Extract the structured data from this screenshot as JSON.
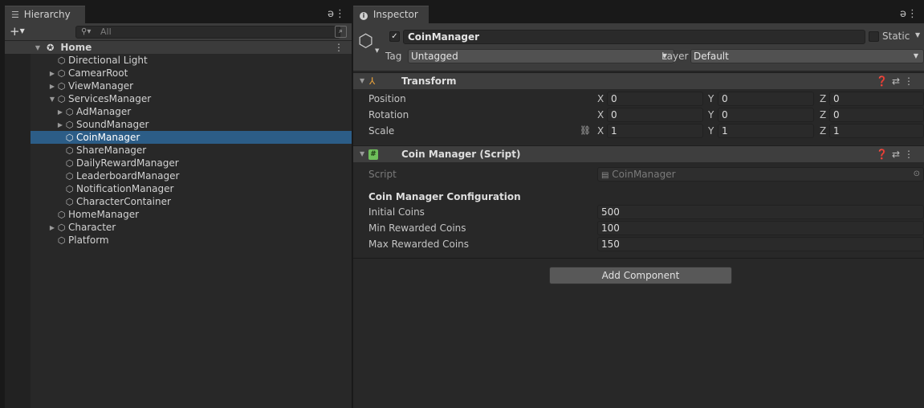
{
  "hierarchy": {
    "tab_label": "Hierarchy",
    "search_placeholder": "All",
    "scene_name": "Home",
    "items": [
      {
        "label": "Directional Light",
        "depth": 1,
        "expander": "",
        "selected": false
      },
      {
        "label": "CamearRoot",
        "depth": 1,
        "expander": "collapsed",
        "selected": false
      },
      {
        "label": "ViewManager",
        "depth": 1,
        "expander": "collapsed",
        "selected": false
      },
      {
        "label": "ServicesManager",
        "depth": 1,
        "expander": "expanded",
        "selected": false
      },
      {
        "label": "AdManager",
        "depth": 2,
        "expander": "collapsed",
        "selected": false
      },
      {
        "label": "SoundManager",
        "depth": 2,
        "expander": "collapsed",
        "selected": false
      },
      {
        "label": "CoinManager",
        "depth": 2,
        "expander": "",
        "selected": true
      },
      {
        "label": "ShareManager",
        "depth": 2,
        "expander": "",
        "selected": false
      },
      {
        "label": "DailyRewardManager",
        "depth": 2,
        "expander": "",
        "selected": false
      },
      {
        "label": "LeaderboardManager",
        "depth": 2,
        "expander": "",
        "selected": false
      },
      {
        "label": "NotificationManager",
        "depth": 2,
        "expander": "",
        "selected": false
      },
      {
        "label": "CharacterContainer",
        "depth": 2,
        "expander": "",
        "selected": false
      },
      {
        "label": "HomeManager",
        "depth": 1,
        "expander": "",
        "selected": false
      },
      {
        "label": "Character",
        "depth": 1,
        "expander": "collapsed",
        "selected": false
      },
      {
        "label": "Platform",
        "depth": 1,
        "expander": "",
        "selected": false
      }
    ]
  },
  "inspector": {
    "tab_label": "Inspector",
    "object_name": "CoinManager",
    "active": true,
    "static_label": "Static",
    "tag_label": "Tag",
    "tag_value": "Untagged",
    "layer_label": "Layer",
    "layer_value": "Default",
    "transform": {
      "title": "Transform",
      "position_label": "Position",
      "rotation_label": "Rotation",
      "scale_label": "Scale",
      "position": {
        "x": "0",
        "y": "0",
        "z": "0"
      },
      "rotation": {
        "x": "0",
        "y": "0",
        "z": "0"
      },
      "scale": {
        "x": "1",
        "y": "1",
        "z": "1"
      },
      "axis_x": "X",
      "axis_y": "Y",
      "axis_z": "Z"
    },
    "script_component": {
      "title": "Coin Manager (Script)",
      "script_label": "Script",
      "script_value": "CoinManager",
      "section_header": "Coin Manager Configuration",
      "initial_coins_label": "Initial Coins",
      "initial_coins": "500",
      "min_rewarded_label": "Min Rewarded Coins",
      "min_rewarded": "100",
      "max_rewarded_label": "Max Rewarded Coins",
      "max_rewarded": "150"
    },
    "add_component_label": "Add Component"
  },
  "icons": {
    "hierarchy_tab": "list-icon",
    "inspector_tab": "info-icon",
    "scene": "unity-scene-icon",
    "gameobject": "cube-icon",
    "transform": "transform-axes-icon",
    "script": "cs-script-icon"
  },
  "colors": {
    "selection": "#2c5d87",
    "panel_bg": "#282828",
    "header_bg": "#3c3c3c"
  }
}
